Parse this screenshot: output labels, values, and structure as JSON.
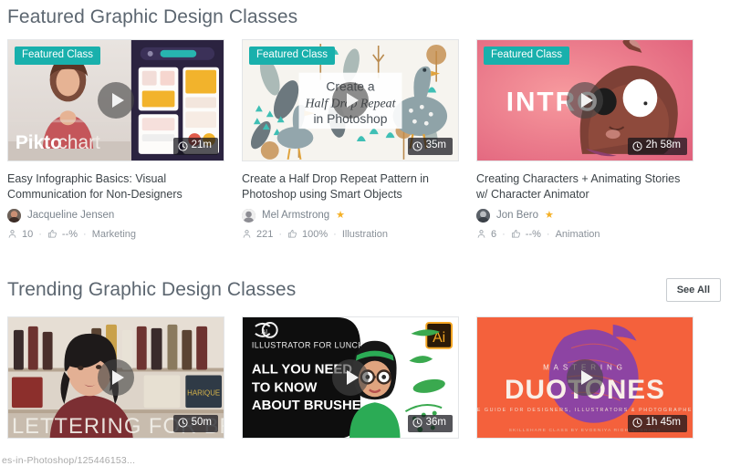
{
  "sections": [
    {
      "title": "Featured Graphic Design Classes",
      "see_all": null,
      "cards": [
        {
          "badge": "Featured Class",
          "duration": "21m",
          "thumb_text": "Piktochart",
          "title": "Easy Infographic Basics: Visual Communication for Non-Designers",
          "teacher": "Jacqueline Jensen",
          "teacher_starred": false,
          "students": "10",
          "rating": "--%",
          "category": "Marketing"
        },
        {
          "badge": "Featured Class",
          "duration": "35m",
          "thumb_text": "Create a Half Drop Repeat in Photoshop",
          "title": "Create a Half Drop Repeat Pattern in Photoshop using Smart Objects",
          "teacher": "Mel Armstrong",
          "teacher_starred": true,
          "students": "221",
          "rating": "100%",
          "category": "Illustration"
        },
        {
          "badge": "Featured Class",
          "duration": "2h 58m",
          "thumb_text": "INTRO",
          "title": "Creating Characters + Animating Stories w/ Character Animator",
          "teacher": "Jon Bero",
          "teacher_starred": true,
          "students": "6",
          "rating": "--%",
          "category": "Animation"
        }
      ]
    },
    {
      "title": "Trending Graphic Design Classes",
      "see_all": "See All",
      "cards": [
        {
          "badge": null,
          "duration": "50m",
          "thumb_text": "LETTERING FOR BRANDS",
          "title": "",
          "teacher": "",
          "teacher_starred": false,
          "students": "",
          "rating": "",
          "category": ""
        },
        {
          "badge": null,
          "duration": "36m",
          "thumb_text": "ALL YOU NEED TO KNOW ABOUT BRUSHES",
          "thumb_sub": "ILLUSTRATOR FOR LUNCH™",
          "thumb_tag": "Ai",
          "title": "",
          "teacher": "",
          "teacher_starred": false,
          "students": "",
          "rating": "",
          "category": ""
        },
        {
          "badge": null,
          "duration": "1h 45m",
          "thumb_text": "DUOTONES",
          "thumb_sub": "MASTERING",
          "thumb_sub2": "THE GUIDE FOR DESIGNERS, ILLUSTRATORS & PHOTOGRAPHERS",
          "thumb_sub3": "SKILLSHARE CLASS BY EVGENIYA RIGHINI-BRAND",
          "title": "",
          "teacher": "",
          "teacher_starred": false,
          "students": "",
          "rating": "",
          "category": ""
        }
      ]
    }
  ],
  "watermark": "es-in-Photoshop/125446153...",
  "icons": {
    "clock": "clock-icon",
    "students": "students-icon",
    "thumbs_up": "thumbs-up-icon",
    "play": "play-icon",
    "star": "star-icon"
  },
  "colors": {
    "featured_badge": "#19b0ac",
    "star": "#f5b025",
    "title_text": "#3d4449",
    "meta_text": "#9aa1a8",
    "section_title": "#5c6670"
  }
}
